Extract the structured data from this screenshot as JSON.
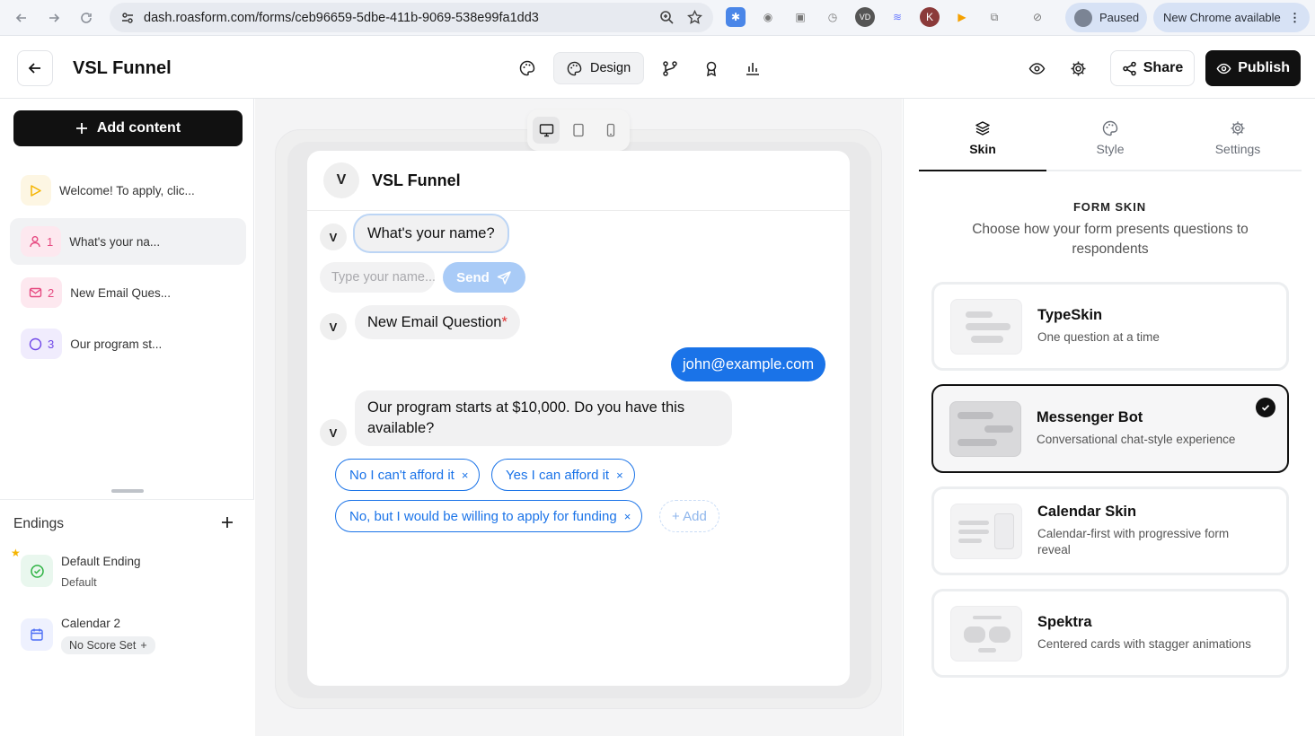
{
  "browser": {
    "url": "dash.roasform.com/forms/ceb96659-5dbe-411b-9069-538e99fa1dd3",
    "profile_status": "Paused",
    "update_label": "New Chrome available"
  },
  "header": {
    "title": "VSL Funnel",
    "design_label": "Design",
    "share_label": "Share",
    "publish_label": "Publish"
  },
  "sidebar": {
    "add_content_label": "Add content",
    "items": [
      {
        "number": "",
        "label": "Welcome! To apply, clic...",
        "icon": "play-icon",
        "color": "#f5b400",
        "bg": "#fdf6e3"
      },
      {
        "number": "1",
        "label": "What's your na...",
        "icon": "user-icon",
        "color": "#e64980",
        "bg": "#fde8ef"
      },
      {
        "number": "2",
        "label": "New Email Ques...",
        "icon": "mail-icon",
        "color": "#e64980",
        "bg": "#fde8ef"
      },
      {
        "number": "3",
        "label": "Our program st...",
        "icon": "circle-icon",
        "color": "#7048e8",
        "bg": "#f0ecfd"
      }
    ],
    "endings_title": "Endings",
    "endings": [
      {
        "name": "Default Ending",
        "sub": "Default",
        "icon": "check-circle-icon",
        "color": "#2fb344",
        "bg": "#e9f7ee"
      },
      {
        "name": "Calendar 2",
        "sub": "No Score Set",
        "icon": "calendar-icon",
        "color": "#4c6ef5",
        "bg": "#eef1fe"
      }
    ]
  },
  "preview": {
    "avatar_letter": "V",
    "title": "VSL Funnel",
    "q1_text": "What's your name?",
    "input_placeholder": "Type your name...",
    "send_label": "Send",
    "q2_text": "New Email Question",
    "required_mark": "*",
    "user_reply": "john@example.com",
    "q3_text": "Our program starts at $10,000. Do you have this available?",
    "chips": [
      "No I can't afford it",
      "Yes I can afford it",
      "No, but I would be willing to apply for funding"
    ],
    "add_chip_label": "+ Add",
    "remove_mark": "×"
  },
  "right_panel": {
    "tabs": [
      "Skin",
      "Style",
      "Settings"
    ],
    "active_tab": "Skin",
    "section_title": "FORM SKIN",
    "section_desc": "Choose how your form presents questions to respondents",
    "skins": [
      {
        "name": "TypeSkin",
        "desc": "One question at a time",
        "selected": false
      },
      {
        "name": "Messenger Bot",
        "desc": "Conversational chat-style experience",
        "selected": true
      },
      {
        "name": "Calendar Skin",
        "desc": "Calendar-first with progressive form reveal",
        "selected": false
      },
      {
        "name": "Spektra",
        "desc": "Centered cards with stagger animations",
        "selected": false
      }
    ]
  },
  "colors": {
    "accent": "#1a73e8",
    "primary_dark": "#111111"
  }
}
